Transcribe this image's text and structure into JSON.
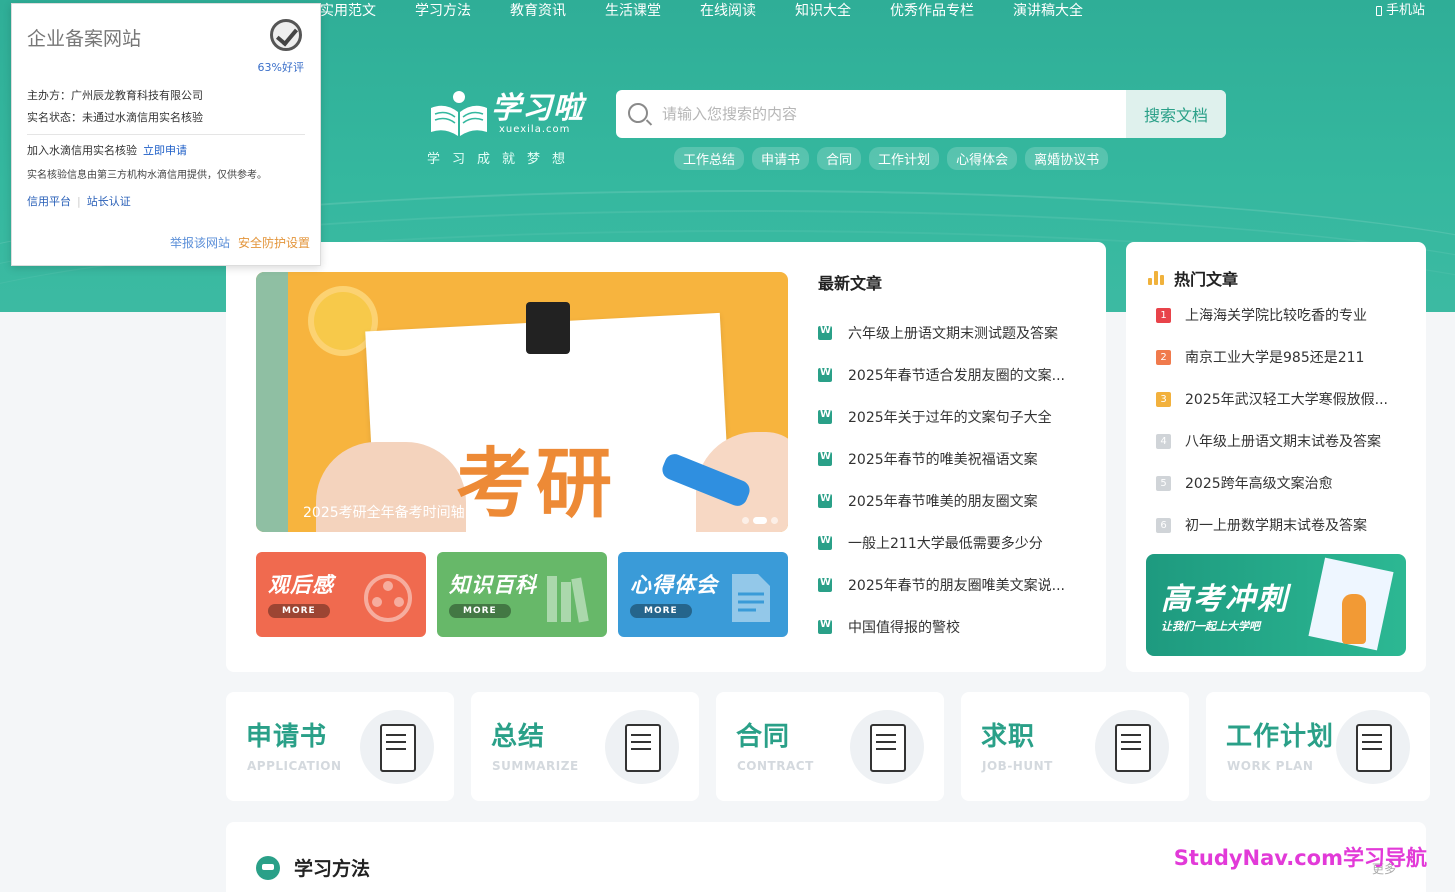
{
  "nav": {
    "items": [
      "实用范文",
      "学习方法",
      "教育资讯",
      "生活课堂",
      "在线阅读",
      "知识大全",
      "优秀作品专栏",
      "演讲稿大全"
    ],
    "mobile": "手机站"
  },
  "logo": {
    "title": "学习啦",
    "domain": "xuexila.com",
    "slogan": "学习成就梦想"
  },
  "search": {
    "placeholder": "请输入您搜索的内容",
    "button": "搜索文档"
  },
  "tags": [
    "工作总结",
    "申请书",
    "合同",
    "工作计划",
    "心得体会",
    "离婚协议书"
  ],
  "popup": {
    "title": "企业备案网站",
    "rating": "63%好评",
    "sponsor": "主办方：广州辰龙教育科技有限公司",
    "status": "实名状态：未通过水滴信用实名核验",
    "join": "加入水滴信用实名核验",
    "apply": "立即申请",
    "note": "实名核验信息由第三方机构水滴信用提供，仅供参考。",
    "credit": "信用平台",
    "owner": "站长认证",
    "report": "举报该网站",
    "security": "安全防护设置"
  },
  "banner": {
    "word": "考研",
    "caption": "2025考研全年备考时间轴"
  },
  "tiles": [
    {
      "title": "观后感",
      "more": "MORE"
    },
    {
      "title": "知识百科",
      "more": "MORE"
    },
    {
      "title": "心得体会",
      "more": "MORE"
    }
  ],
  "latest": {
    "title": "最新文章",
    "items": [
      "六年级上册语文期末测试题及答案",
      "2025年春节适合发朋友圈的文案...",
      "2025年关于过年的文案句子大全",
      "2025年春节的唯美祝福语文案",
      "2025年春节唯美的朋友圈文案",
      "一般上211大学最低需要多少分",
      "2025年春节的朋友圈唯美文案说...",
      "中国值得报的警校"
    ]
  },
  "hot": {
    "title": "热门文章",
    "items": [
      {
        "rank": "1",
        "text": "上海海关学院比较吃香的专业",
        "color": "#e8434a"
      },
      {
        "rank": "2",
        "text": "南京工业大学是985还是211",
        "color": "#f07a4c"
      },
      {
        "rank": "3",
        "text": "2025年武汉轻工大学寒假放假...",
        "color": "#f2b13d"
      },
      {
        "rank": "4",
        "text": "八年级上册语文期末试卷及答案",
        "color": "#d0d4d8"
      },
      {
        "rank": "5",
        "text": "2025跨年高级文案治愈",
        "color": "#d0d4d8"
      },
      {
        "rank": "6",
        "text": "初一上册数学期末试卷及答案",
        "color": "#d0d4d8"
      }
    ],
    "banner_title": "高考冲刺",
    "banner_sub": "让我们一起上大学吧"
  },
  "categories": [
    {
      "name": "申请书",
      "en": "APPLICATION"
    },
    {
      "name": "总结",
      "en": "SUMMARIZE"
    },
    {
      "name": "合同",
      "en": "CONTRACT"
    },
    {
      "name": "求职",
      "en": "JOB-HUNT"
    },
    {
      "name": "工作计划",
      "en": "WORK PLAN"
    }
  ],
  "section": {
    "title": "学习方法",
    "more": "更多"
  },
  "watermark": "StudyNav.com学习导航",
  "colors": {
    "brand": "#2aa088",
    "hero": "#35b89f"
  }
}
